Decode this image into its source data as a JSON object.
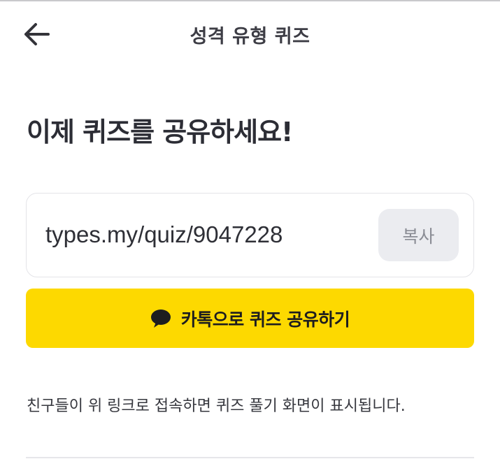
{
  "header": {
    "title": "성격 유형 퀴즈",
    "back_icon": "arrow-left-icon"
  },
  "main": {
    "headline": "이제 퀴즈를 공유하세요!",
    "share_link": {
      "url": "types.my/quiz/9047228",
      "copy_label": "복사"
    },
    "kakao_button": {
      "label": "카톡으로 퀴즈 공유하기",
      "icon": "speech-bubble-icon",
      "color": "#FDD900"
    },
    "info_text": "친구들이 위 링크로 접속하면 퀴즈 풀기 화면이 표시됩니다."
  }
}
